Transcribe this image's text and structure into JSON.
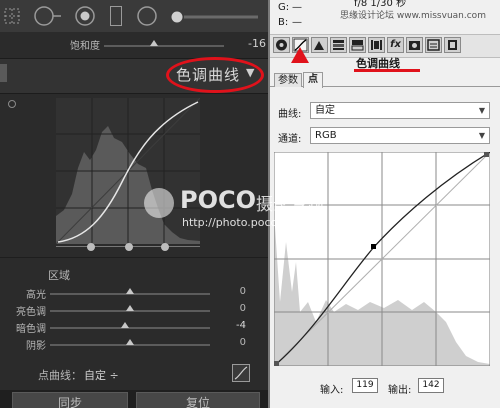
{
  "left_panel": {
    "saturation_label": "饱和度",
    "saturation_value": -16,
    "saturation_level": 0.42,
    "panel_title": "色调曲线",
    "region_label": "区域",
    "sliders": [
      {
        "label": "高光",
        "value": "0",
        "level": 0.5
      },
      {
        "label": "亮色调",
        "value": "0",
        "level": 0.5
      },
      {
        "label": "暗色调",
        "value": "-4",
        "level": 0.47
      },
      {
        "label": "阴影",
        "value": "0",
        "level": 0.5
      }
    ],
    "point_curve_label": "点曲线：",
    "point_curve_value": "自定 ÷",
    "sync_button": "同步",
    "reset_button": "复位",
    "watermark_brand": "POCO",
    "watermark_cn": "摄影专题",
    "watermark_url": "http://photo.poco.cn/",
    "watermark_extra": "思缘设计论坛 www.missvuan.com",
    "annotation_color": "#e0121b"
  },
  "right_panel": {
    "rgb_g_label": "G:",
    "rgb_b_label": "B:",
    "rgb_dash_g": "—",
    "rgb_dash_b": "—",
    "exposure_info": "f/8  1/30 秒",
    "tab_title": "色调曲线",
    "subtabs": [
      "参数",
      "点"
    ],
    "curve_label": "曲线:",
    "curve_value": "自定",
    "channel_label": "通道:",
    "channel_value": "RGB",
    "input_label": "输入:",
    "input_value": "119",
    "output_label": "输出:",
    "output_value": "142",
    "icons": [
      "aperture-icon",
      "curve-icon",
      "mountain-icon",
      "hsl-icon",
      "split-tone-icon",
      "lens-icon",
      "fx-icon",
      "camera-icon",
      "preset-icon",
      "snapshot-icon"
    ],
    "fx_text": "fx"
  }
}
